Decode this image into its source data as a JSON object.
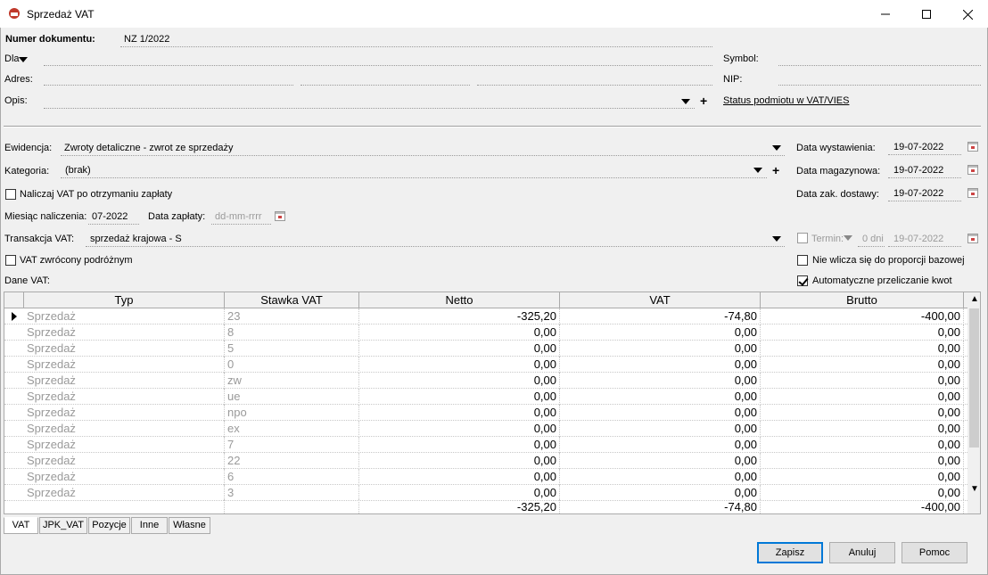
{
  "window": {
    "title": "Sprzedaż VAT"
  },
  "header": {
    "doc_number_label": "Numer dokumentu:",
    "doc_number_value": "NZ 1/2022",
    "dla_label": "Dla",
    "symbol_label": "Symbol:",
    "adres_label": "Adres:",
    "nip_label": "NIP:",
    "opis_label": "Opis:",
    "status_link": "Status podmiotu w VAT/VIES"
  },
  "details": {
    "ewidencja_label": "Ewidencja:",
    "ewidencja_value": "Zwroty detaliczne - zwrot ze sprzedaży",
    "kategoria_label": "Kategoria:",
    "kategoria_value": "(brak)",
    "naliczaj_label": "Naliczaj VAT po otrzymaniu zapłaty",
    "miesiac_label": "Miesiąc naliczenia:",
    "miesiac_value": "07-2022",
    "data_zaplaty_label": "Data zapłaty:",
    "data_zaplaty_placeholder": "dd-mm-rrrr",
    "transakcja_label": "Transakcja VAT:",
    "transakcja_value": "sprzedaż krajowa - S",
    "vat_zwrocony_label": "VAT zwrócony podróżnym",
    "dane_vat_label": "Dane VAT:",
    "data_wystawienia_label": "Data wystawienia:",
    "data_wystawienia_value": "19-07-2022",
    "data_magazynowa_label": "Data magazynowa:",
    "data_magazynowa_value": "19-07-2022",
    "data_zak_label": "Data zak. dostawy:",
    "data_zak_value": "19-07-2022",
    "termin_label": "Termin:",
    "termin_days": "0 dni",
    "termin_date": "19-07-2022",
    "nie_wlicza_label": "Nie wlicza się do proporcji bazowej",
    "auto_label": "Automatyczne przeliczanie kwot"
  },
  "grid": {
    "columns": [
      "Typ",
      "Stawka VAT",
      "Netto",
      "VAT",
      "Brutto"
    ],
    "rows": [
      [
        "Sprzedaż",
        "23",
        "-325,20",
        "-74,80",
        "-400,00"
      ],
      [
        "Sprzedaż",
        "8",
        "0,00",
        "0,00",
        "0,00"
      ],
      [
        "Sprzedaż",
        "5",
        "0,00",
        "0,00",
        "0,00"
      ],
      [
        "Sprzedaż",
        "0",
        "0,00",
        "0,00",
        "0,00"
      ],
      [
        "Sprzedaż",
        "zw",
        "0,00",
        "0,00",
        "0,00"
      ],
      [
        "Sprzedaż",
        "ue",
        "0,00",
        "0,00",
        "0,00"
      ],
      [
        "Sprzedaż",
        "npo",
        "0,00",
        "0,00",
        "0,00"
      ],
      [
        "Sprzedaż",
        "ex",
        "0,00",
        "0,00",
        "0,00"
      ],
      [
        "Sprzedaż",
        "7",
        "0,00",
        "0,00",
        "0,00"
      ],
      [
        "Sprzedaż",
        "22",
        "0,00",
        "0,00",
        "0,00"
      ],
      [
        "Sprzedaż",
        "6",
        "0,00",
        "0,00",
        "0,00"
      ],
      [
        "Sprzedaż",
        "3",
        "0,00",
        "0,00",
        "0,00"
      ]
    ],
    "totals": {
      "netto": "-325,20",
      "vat": "-74,80",
      "brutto": "-400,00"
    }
  },
  "tabs": [
    "VAT",
    "JPK_VAT",
    "Pozycje",
    "Inne",
    "Własne"
  ],
  "buttons": {
    "save": "Zapisz",
    "cancel": "Anuluj",
    "help": "Pomoc"
  }
}
